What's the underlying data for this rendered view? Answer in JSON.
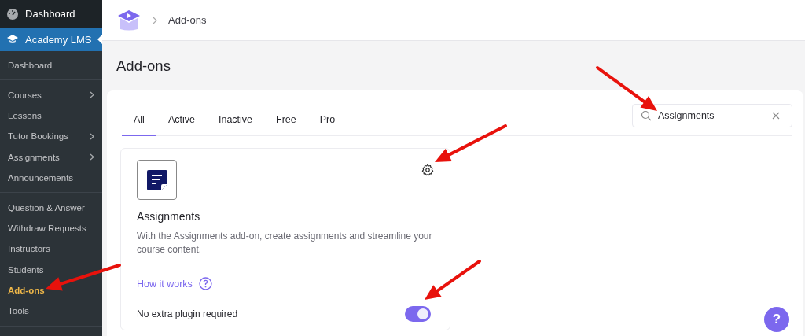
{
  "admin_menu": [
    {
      "label": "Dashboard",
      "selected": false
    },
    {
      "label": "Academy LMS",
      "selected": true
    }
  ],
  "submenu": [
    {
      "items": [
        {
          "label": "Dashboard",
          "selected": false,
          "has_submenu": false
        }
      ]
    },
    {
      "items": [
        {
          "label": "Courses",
          "selected": false,
          "has_submenu": true
        },
        {
          "label": "Lessons",
          "selected": false,
          "has_submenu": false
        },
        {
          "label": "Tutor Bookings",
          "selected": false,
          "has_submenu": true
        },
        {
          "label": "Assignments",
          "selected": false,
          "has_submenu": true
        },
        {
          "label": "Announcements",
          "selected": false,
          "has_submenu": false
        }
      ]
    },
    {
      "items": [
        {
          "label": "Question & Answer",
          "selected": false,
          "has_submenu": false
        },
        {
          "label": "Withdraw Requests",
          "selected": false,
          "has_submenu": false
        },
        {
          "label": "Instructors",
          "selected": false,
          "has_submenu": false
        },
        {
          "label": "Students",
          "selected": false,
          "has_submenu": false
        },
        {
          "label": "Add-ons",
          "selected": true,
          "has_submenu": false
        },
        {
          "label": "Tools",
          "selected": false,
          "has_submenu": false
        }
      ]
    }
  ],
  "breadcrumb": [
    "Add-ons"
  ],
  "page_title": "Add-ons",
  "tabs": [
    {
      "label": "All",
      "selected": true
    },
    {
      "label": "Active",
      "selected": false
    },
    {
      "label": "Inactive",
      "selected": false
    },
    {
      "label": "Free",
      "selected": false
    },
    {
      "label": "Pro",
      "selected": false
    }
  ],
  "search": {
    "value": "Assignments"
  },
  "addons": [
    {
      "title": "Assignments",
      "description": "With the Assignments add-on, create assignments and streamline your course content.",
      "link": "How it works",
      "requirement": "No extra plugin required",
      "enabled": true
    }
  ],
  "help_button": "?"
}
